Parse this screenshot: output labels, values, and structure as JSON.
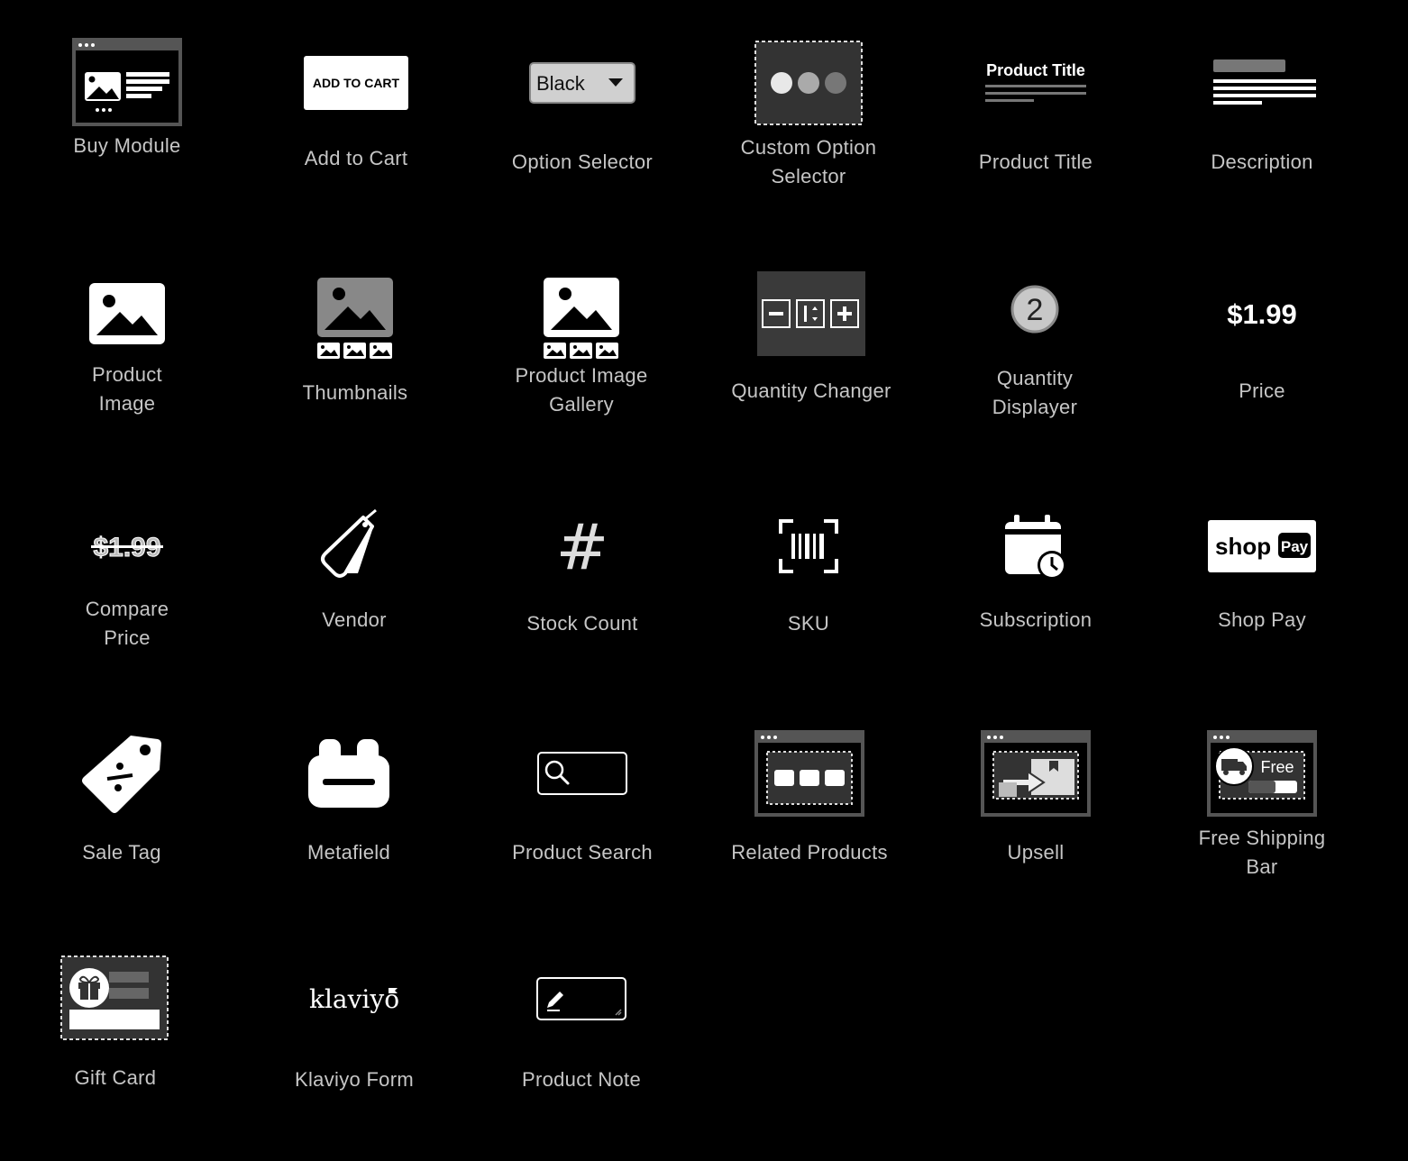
{
  "colors": {
    "background": "#000000",
    "icon": "#ffffff",
    "label": "#c6c6c6",
    "panel": "#3a3a3a",
    "frame": "#555555"
  },
  "icon_texts": {
    "add_to_cart": "ADD TO CART",
    "option_value": "Black",
    "product_title": "Product Title",
    "quantity": "2",
    "price": "$1.99",
    "compare_price": "$1.99",
    "stock_symbol": "#",
    "shop_pay_shop": "shop",
    "shop_pay_pay": "Pay",
    "free_shipping": "Free",
    "klaviyo": "klaviyo"
  },
  "blocks": [
    {
      "id": "buy-module",
      "label": "Buy Module",
      "icon": "buy-module-icon"
    },
    {
      "id": "add-to-cart",
      "label": "Add to Cart",
      "icon": "add-to-cart-icon"
    },
    {
      "id": "option-selector",
      "label": "Option Selector",
      "icon": "option-selector-icon"
    },
    {
      "id": "custom-option-selector",
      "label": "Custom Option Selector",
      "icon": "custom-option-selector-icon"
    },
    {
      "id": "product-title",
      "label": "Product Title",
      "icon": "product-title-icon"
    },
    {
      "id": "description",
      "label": "Description",
      "icon": "description-icon"
    },
    {
      "id": "product-image",
      "label": "Product Image",
      "icon": "image-icon"
    },
    {
      "id": "thumbnails",
      "label": "Thumbnails",
      "icon": "thumbnails-icon"
    },
    {
      "id": "product-image-gallery",
      "label": "Product Image Gallery",
      "icon": "gallery-icon"
    },
    {
      "id": "quantity-changer",
      "label": "Quantity Changer",
      "icon": "quantity-changer-icon"
    },
    {
      "id": "quantity-displayer",
      "label": "Quantity Displayer",
      "icon": "quantity-badge-icon"
    },
    {
      "id": "price",
      "label": "Price",
      "icon": "price-icon"
    },
    {
      "id": "compare-price",
      "label": "Compare Price",
      "icon": "strikethrough-price-icon"
    },
    {
      "id": "vendor",
      "label": "Vendor",
      "icon": "tag-icon"
    },
    {
      "id": "stock-count",
      "label": "Stock Count",
      "icon": "hash-icon"
    },
    {
      "id": "sku",
      "label": "SKU",
      "icon": "barcode-icon"
    },
    {
      "id": "subscription",
      "label": "Subscription",
      "icon": "calendar-clock-icon"
    },
    {
      "id": "shop-pay",
      "label": "Shop Pay",
      "icon": "shop-pay-icon"
    },
    {
      "id": "sale-tag",
      "label": "Sale Tag",
      "icon": "percent-tag-icon"
    },
    {
      "id": "metafield",
      "label": "Metafield",
      "icon": "metafield-icon"
    },
    {
      "id": "product-search",
      "label": "Product Search",
      "icon": "search-icon"
    },
    {
      "id": "related-products",
      "label": "Related Products",
      "icon": "related-products-icon"
    },
    {
      "id": "upsell",
      "label": "Upsell",
      "icon": "upsell-icon"
    },
    {
      "id": "free-shipping-bar",
      "label": "Free Shipping Bar",
      "icon": "truck-icon"
    },
    {
      "id": "gift-card",
      "label": "Gift Card",
      "icon": "gift-icon"
    },
    {
      "id": "klaviyo-form",
      "label": "Klaviyo Form",
      "icon": "klaviyo-logo-icon"
    },
    {
      "id": "product-note",
      "label": "Product Note",
      "icon": "pencil-icon"
    }
  ]
}
